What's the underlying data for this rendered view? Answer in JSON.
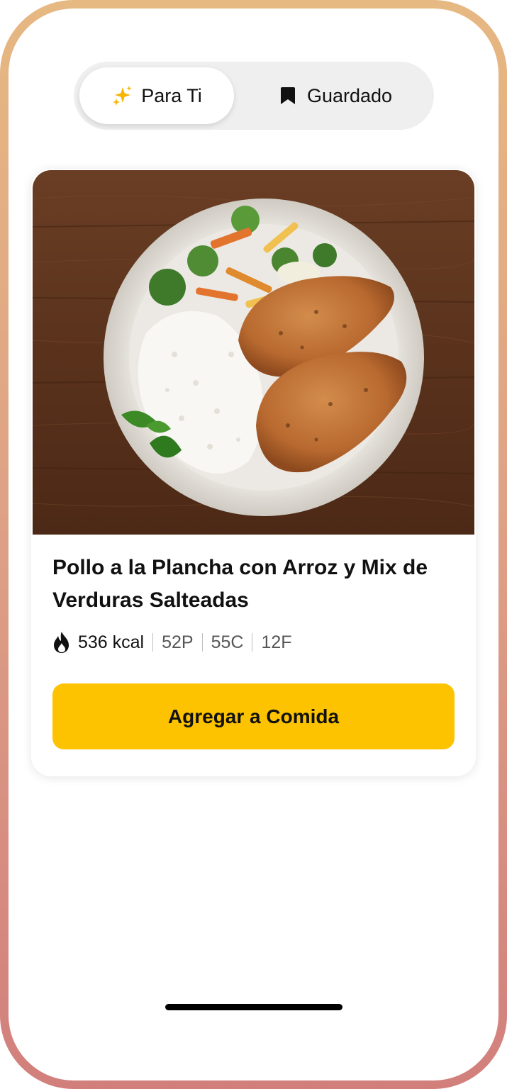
{
  "tabs": [
    {
      "label": "Para Ti",
      "icon": "sparkles-icon",
      "active": true
    },
    {
      "label": "Guardado",
      "icon": "bookmark-icon",
      "active": false
    }
  ],
  "meal": {
    "title": "Pollo a la Plancha con Arroz y Mix de Verduras Salteadas",
    "calories": "536 kcal",
    "protein": "52P",
    "carbs": "55C",
    "fat": "12F",
    "image_description": "Grilled chicken breasts with white rice and sautéed vegetables on a plate over a wooden table"
  },
  "actions": {
    "add_label": "Agregar a Comida"
  },
  "colors": {
    "accent": "#FDC300",
    "frame_top": "#E6B882",
    "frame_bottom": "#D27F7C",
    "segment_bg": "#EFEFEF"
  }
}
